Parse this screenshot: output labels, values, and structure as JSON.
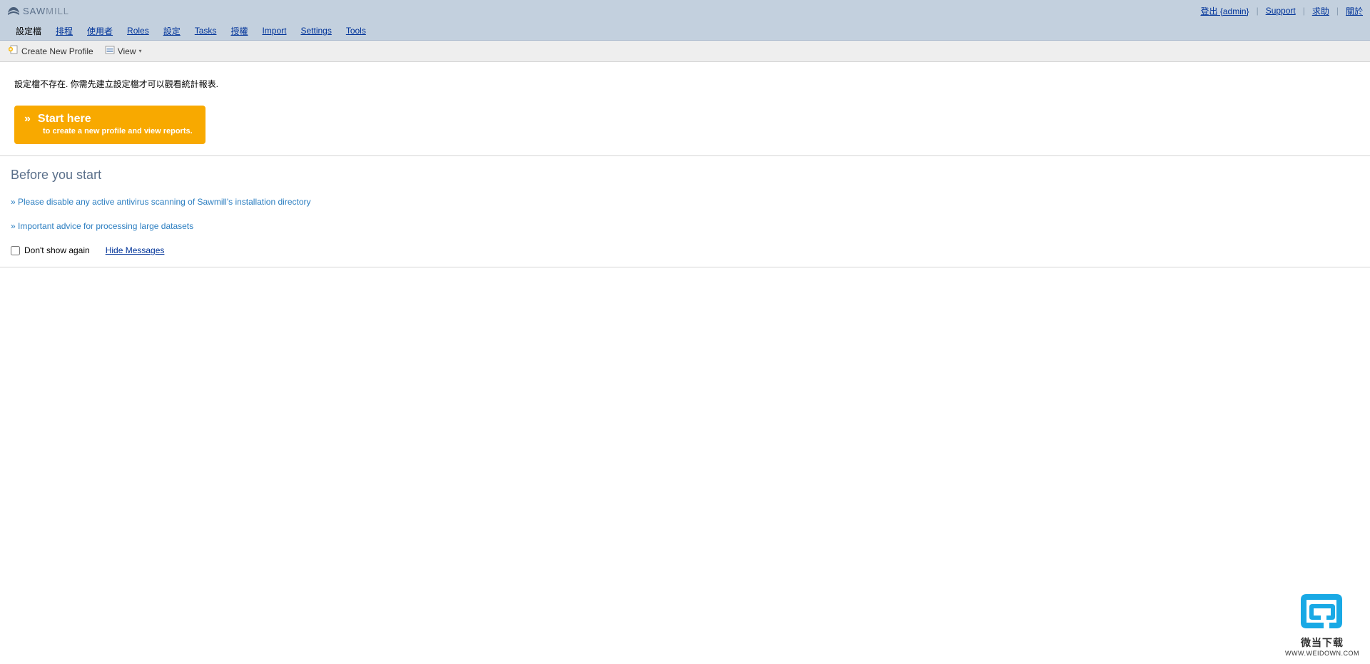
{
  "brand": {
    "saw": "SAW",
    "mill": "MILL"
  },
  "top_links": {
    "logout": "登出 {admin}",
    "support": "Support",
    "help": "求助",
    "about": "關於"
  },
  "nav": {
    "profiles": "設定檔",
    "scheduler": "排程",
    "users": "使用者",
    "roles": "Roles",
    "config": "設定",
    "tasks": "Tasks",
    "license": "授權",
    "import": "Import",
    "settings": "Settings",
    "tools": "Tools"
  },
  "toolbar": {
    "create_profile": "Create New Profile",
    "view": "View"
  },
  "main": {
    "no_profile_msg": "設定檔不存在. 你需先建立設定檔才可以觀看統計報表.",
    "start_here": "Start here",
    "start_subtitle": "to create a new profile and view reports."
  },
  "before": {
    "title": "Before you start",
    "tip1": "» Please disable any active antivirus scanning of Sawmill's installation directory",
    "tip2": "» Important advice for processing large datasets",
    "dont_show": "Don't show again",
    "hide_messages": "Hide Messages"
  },
  "watermark": {
    "text": "微当下载",
    "url": "WWW.WEIDOWN.COM"
  }
}
